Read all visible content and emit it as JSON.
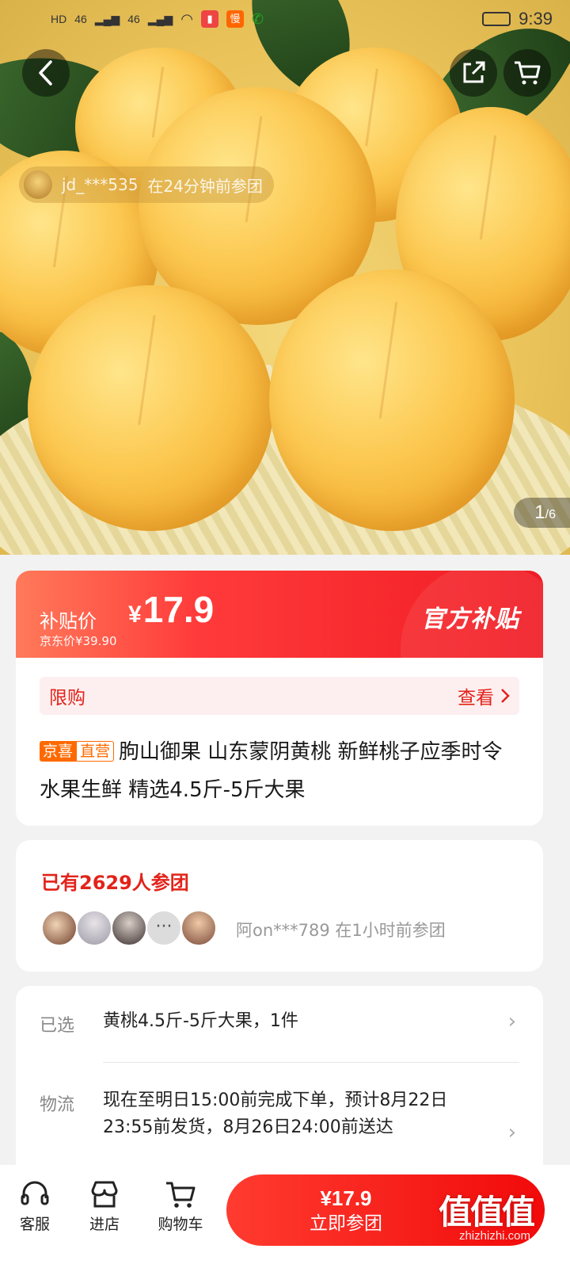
{
  "status_bar": {
    "network_labels": [
      "HD",
      "46",
      "46"
    ],
    "app_badges": [
      "▮",
      "慢"
    ],
    "time": "9:39"
  },
  "hero": {
    "joined_toast": {
      "user": "jd_***535",
      "text": "在24分钟前参团"
    },
    "pager": {
      "current": "1",
      "total": "/6"
    },
    "icons": {
      "back": "chevron-left-icon",
      "share": "share-icon",
      "cart": "cart-icon"
    }
  },
  "price": {
    "label": "补贴价",
    "currency": "¥",
    "value": "17.9",
    "original": "京东价¥39.90",
    "official_tag": "官方补贴"
  },
  "product": {
    "limit_label": "限购",
    "limit_action": "查看",
    "tags": [
      "京喜",
      "直营"
    ],
    "title": "朐山御果 山东蒙阴黄桃 新鲜桃子应季时令水果生鲜 精选4.5斤-5斤大果"
  },
  "group": {
    "count_text": "已有2629人参团",
    "more": "···",
    "recent": "阿on***789 在1小时前参团"
  },
  "spec": {
    "selected_label": "已选",
    "selected_value": "黄桃4.5斤-5斤大果，1件",
    "logistics_label": "物流",
    "logistics_value": "现在至明日15:00前完成下单，预计8月22日23:55前发货，8月26日24:00前送达"
  },
  "bottom_bar": {
    "service": "客服",
    "store": "进店",
    "cart": "购物车",
    "cta_price": "¥17.9",
    "cta_label": "立即参团",
    "watermark": "值值值",
    "watermark_sub": "zhizhizhi.com"
  },
  "colors": {
    "accent": "#e2231a",
    "cta": "#f10a0a",
    "tag": "#ff6a00"
  }
}
